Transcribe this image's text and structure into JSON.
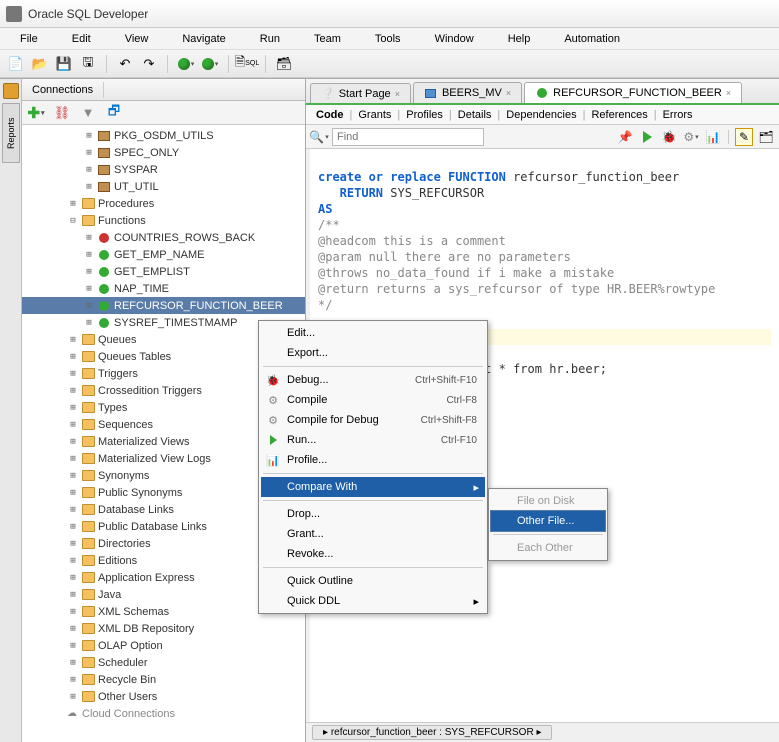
{
  "window": {
    "title": "Oracle SQL Developer"
  },
  "menu": {
    "file": "File",
    "edit": "Edit",
    "view": "View",
    "navigate": "Navigate",
    "run": "Run",
    "team": "Team",
    "tools": "Tools",
    "window": "Window",
    "help": "Help",
    "automation": "Automation"
  },
  "connections": {
    "panel_title": "Connections",
    "tree": {
      "pkg_osdm": "PKG_OSDM_UTILS",
      "spec_only": "SPEC_ONLY",
      "syspar": "SYSPAR",
      "ut_util": "UT_UTIL",
      "procedures": "Procedures",
      "functions": "Functions",
      "fn_countries": "COUNTRIES_ROWS_BACK",
      "fn_get_emp_name": "GET_EMP_NAME",
      "fn_get_emplist": "GET_EMPLIST",
      "fn_nap": "NAP_TIME",
      "fn_refcursor": "REFCURSOR_FUNCTION_BEER",
      "fn_sysref": "SYSREF_TIMESTMAMP",
      "queues": "Queues",
      "queues_tables": "Queues Tables",
      "triggers": "Triggers",
      "crossedition": "Crossedition Triggers",
      "types": "Types",
      "sequences": "Sequences",
      "mviews": "Materialized Views",
      "mview_logs": "Materialized View Logs",
      "synonyms": "Synonyms",
      "public_synonyms": "Public Synonyms",
      "db_links": "Database Links",
      "public_db_links": "Public Database Links",
      "directories": "Directories",
      "editions": "Editions",
      "apex": "Application Express",
      "java": "Java",
      "xml_schemas": "XML Schemas",
      "xml_db": "XML DB Repository",
      "olap": "OLAP Option",
      "scheduler": "Scheduler",
      "recycle": "Recycle Bin",
      "other_users": "Other Users",
      "cloud": "Cloud Connections"
    }
  },
  "lefttabs": {
    "reports": "Reports"
  },
  "editor": {
    "tabs": {
      "start": "Start Page",
      "beers": "BEERS_MV",
      "refcursor": "REFCURSOR_FUNCTION_BEER"
    },
    "subtabs": [
      "Code",
      "Grants",
      "Profiles",
      "Details",
      "Dependencies",
      "References",
      "Errors"
    ],
    "find_placeholder": "Find",
    "code_lines": {
      "l1a": "create or replace ",
      "l1b": "FUNCTION",
      "l1c": " refcursor_function_beer",
      "l2a": "   RETURN",
      "l2b": " SYS_REFCURSOR",
      "l3": "AS",
      "l4": "/**",
      "l5": "@headcom this is a comment",
      "l6": "@param null there are no parameters",
      "l7": "@throws no_data_found if i make a mistake",
      "l8": "@return returns a sys_refcursor of type HR.BEER%rowtype",
      "l9": "*/",
      "l10": "",
      "l12": "t * from hr.beer;"
    },
    "breadcrumb": "refcursor_function_beer : SYS_REFCURSOR"
  },
  "context_menu": {
    "edit": "Edit...",
    "export": "Export...",
    "debug": "Debug...",
    "compile": "Compile",
    "compile_dbg": "Compile for Debug",
    "run": "Run...",
    "profile": "Profile...",
    "compare": "Compare With",
    "drop": "Drop...",
    "grant": "Grant...",
    "revoke": "Revoke...",
    "quick_outline": "Quick Outline",
    "quick_ddl": "Quick DDL",
    "sc_debug": "Ctrl+Shift-F10",
    "sc_compile": "Ctrl-F8",
    "sc_compile_dbg": "Ctrl+Shift-F8",
    "sc_run": "Ctrl-F10",
    "sub_file": "File on Disk",
    "sub_other": "Other File...",
    "sub_each": "Each Other"
  }
}
